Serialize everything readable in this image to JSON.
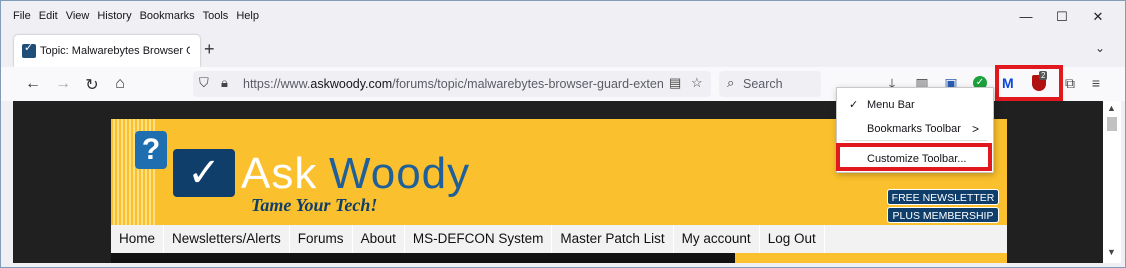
{
  "menubar": {
    "items": [
      "File",
      "Edit",
      "View",
      "History",
      "Bookmarks",
      "Tools",
      "Help"
    ]
  },
  "window_controls": {
    "minimize": "—",
    "maximize": "☐",
    "close": "✕"
  },
  "tab": {
    "title": "Topic: Malwarebytes Browser G",
    "new_tab": "+",
    "list_all": "⌄"
  },
  "navbar": {
    "back": "←",
    "forward": "→",
    "reload": "↻",
    "home": "⌂",
    "url_prefix": "https://www.",
    "url_host": "askwoody.com",
    "url_path": "/forums/topic/malwarebytes-browser-guard-extension-i",
    "search_placeholder": "Search"
  },
  "toolbar_icons": [
    "download-icon",
    "library-icon",
    "save-to-pocket-icon",
    "green-check-extension-icon",
    "malwarebytes-icon",
    "browser-guard-icon",
    "extensions-icon",
    "app-menu-icon"
  ],
  "extension_badge": "2",
  "context_menu": {
    "items": [
      {
        "label": "Menu Bar",
        "checked": true
      },
      {
        "label": "Bookmarks Toolbar",
        "submenu": true
      },
      {
        "label": "Customize Toolbar..."
      }
    ],
    "check_mark": "✓",
    "submenu_arrow": ">"
  },
  "site": {
    "logo_ask": "Ask",
    "logo_woody": "Woody",
    "tagline": "Tame Your Tech!",
    "side_buttons": [
      "FREE NEWSLETTER",
      "PLUS MEMBERSHIP"
    ],
    "nav_items": [
      "Home",
      "Newsletters/Alerts",
      "Forums",
      "About",
      "MS-DEFCON System",
      "Master Patch List",
      "My account",
      "Log Out"
    ]
  },
  "colors": {
    "highlight_red": "#e1191f",
    "site_yellow": "#fbc02d",
    "site_navy": "#0f3e6b"
  }
}
